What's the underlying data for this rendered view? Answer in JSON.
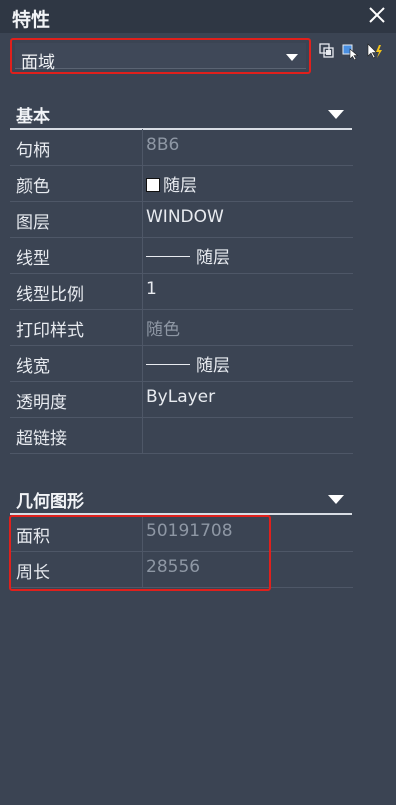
{
  "panel": {
    "title": "特性"
  },
  "selector": {
    "value": "面域"
  },
  "toolbar": {
    "icons": [
      "quick-select-icon",
      "select-objects-icon",
      "toggle-pickadd-icon"
    ]
  },
  "sections": {
    "basic": {
      "title": "基本",
      "rows": [
        {
          "label": "句柄",
          "value": "8B6",
          "muted": true
        },
        {
          "label": "颜色",
          "value": "随层",
          "swatch": "#ffffff"
        },
        {
          "label": "图层",
          "value": "WINDOW"
        },
        {
          "label": "线型",
          "value": "随层",
          "line": true
        },
        {
          "label": "线型比例",
          "value": "1"
        },
        {
          "label": "打印样式",
          "value": "随色",
          "muted": true
        },
        {
          "label": "线宽",
          "value": "随层",
          "line": true
        },
        {
          "label": "透明度",
          "value": "ByLayer"
        },
        {
          "label": "超链接",
          "value": ""
        }
      ]
    },
    "geometry": {
      "title": "几何图形",
      "rows": [
        {
          "label": "面积",
          "value": "50191708",
          "muted": true
        },
        {
          "label": "周长",
          "value": "28556",
          "muted": true
        }
      ]
    }
  },
  "colors": {
    "highlight": "#e0201c",
    "panel_bg": "#3b4453"
  }
}
